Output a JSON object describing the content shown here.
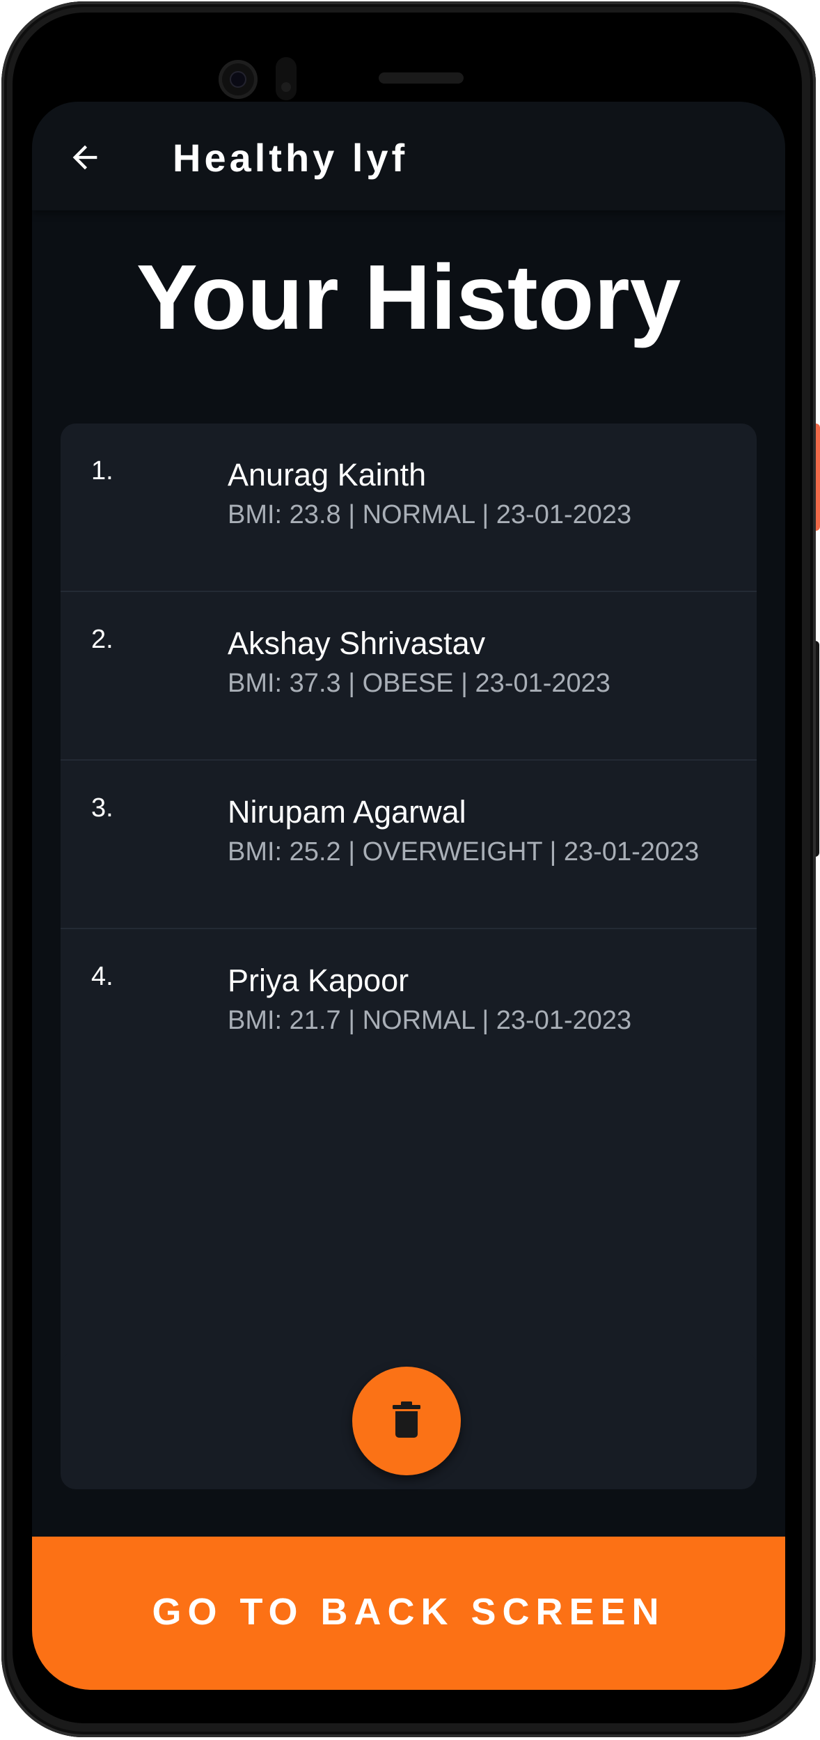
{
  "app": {
    "title": "Healthy lyf"
  },
  "page": {
    "title": "Your History"
  },
  "history": [
    {
      "index": "1.",
      "name": "Anurag Kainth",
      "detail": "BMI: 23.8 | NORMAL | 23-01-2023"
    },
    {
      "index": "2.",
      "name": "Akshay Shrivastav",
      "detail": "BMI: 37.3 | OBESE | 23-01-2023"
    },
    {
      "index": "3.",
      "name": "Nirupam Agarwal",
      "detail": "BMI: 25.2 | OVERWEIGHT | 23-01-2023"
    },
    {
      "index": "4.",
      "name": "Priya Kapoor",
      "detail": "BMI: 21.7 | NORMAL | 23-01-2023"
    }
  ],
  "actions": {
    "delete_icon": "trash-icon",
    "back_icon": "arrow-left-icon",
    "bottom_button_label": "GO TO BACK SCREEN"
  },
  "colors": {
    "accent": "#fc7115",
    "background": "#0b0f14",
    "card": "#171c24",
    "text_primary": "#ffffff",
    "text_secondary": "#a9afb7"
  }
}
